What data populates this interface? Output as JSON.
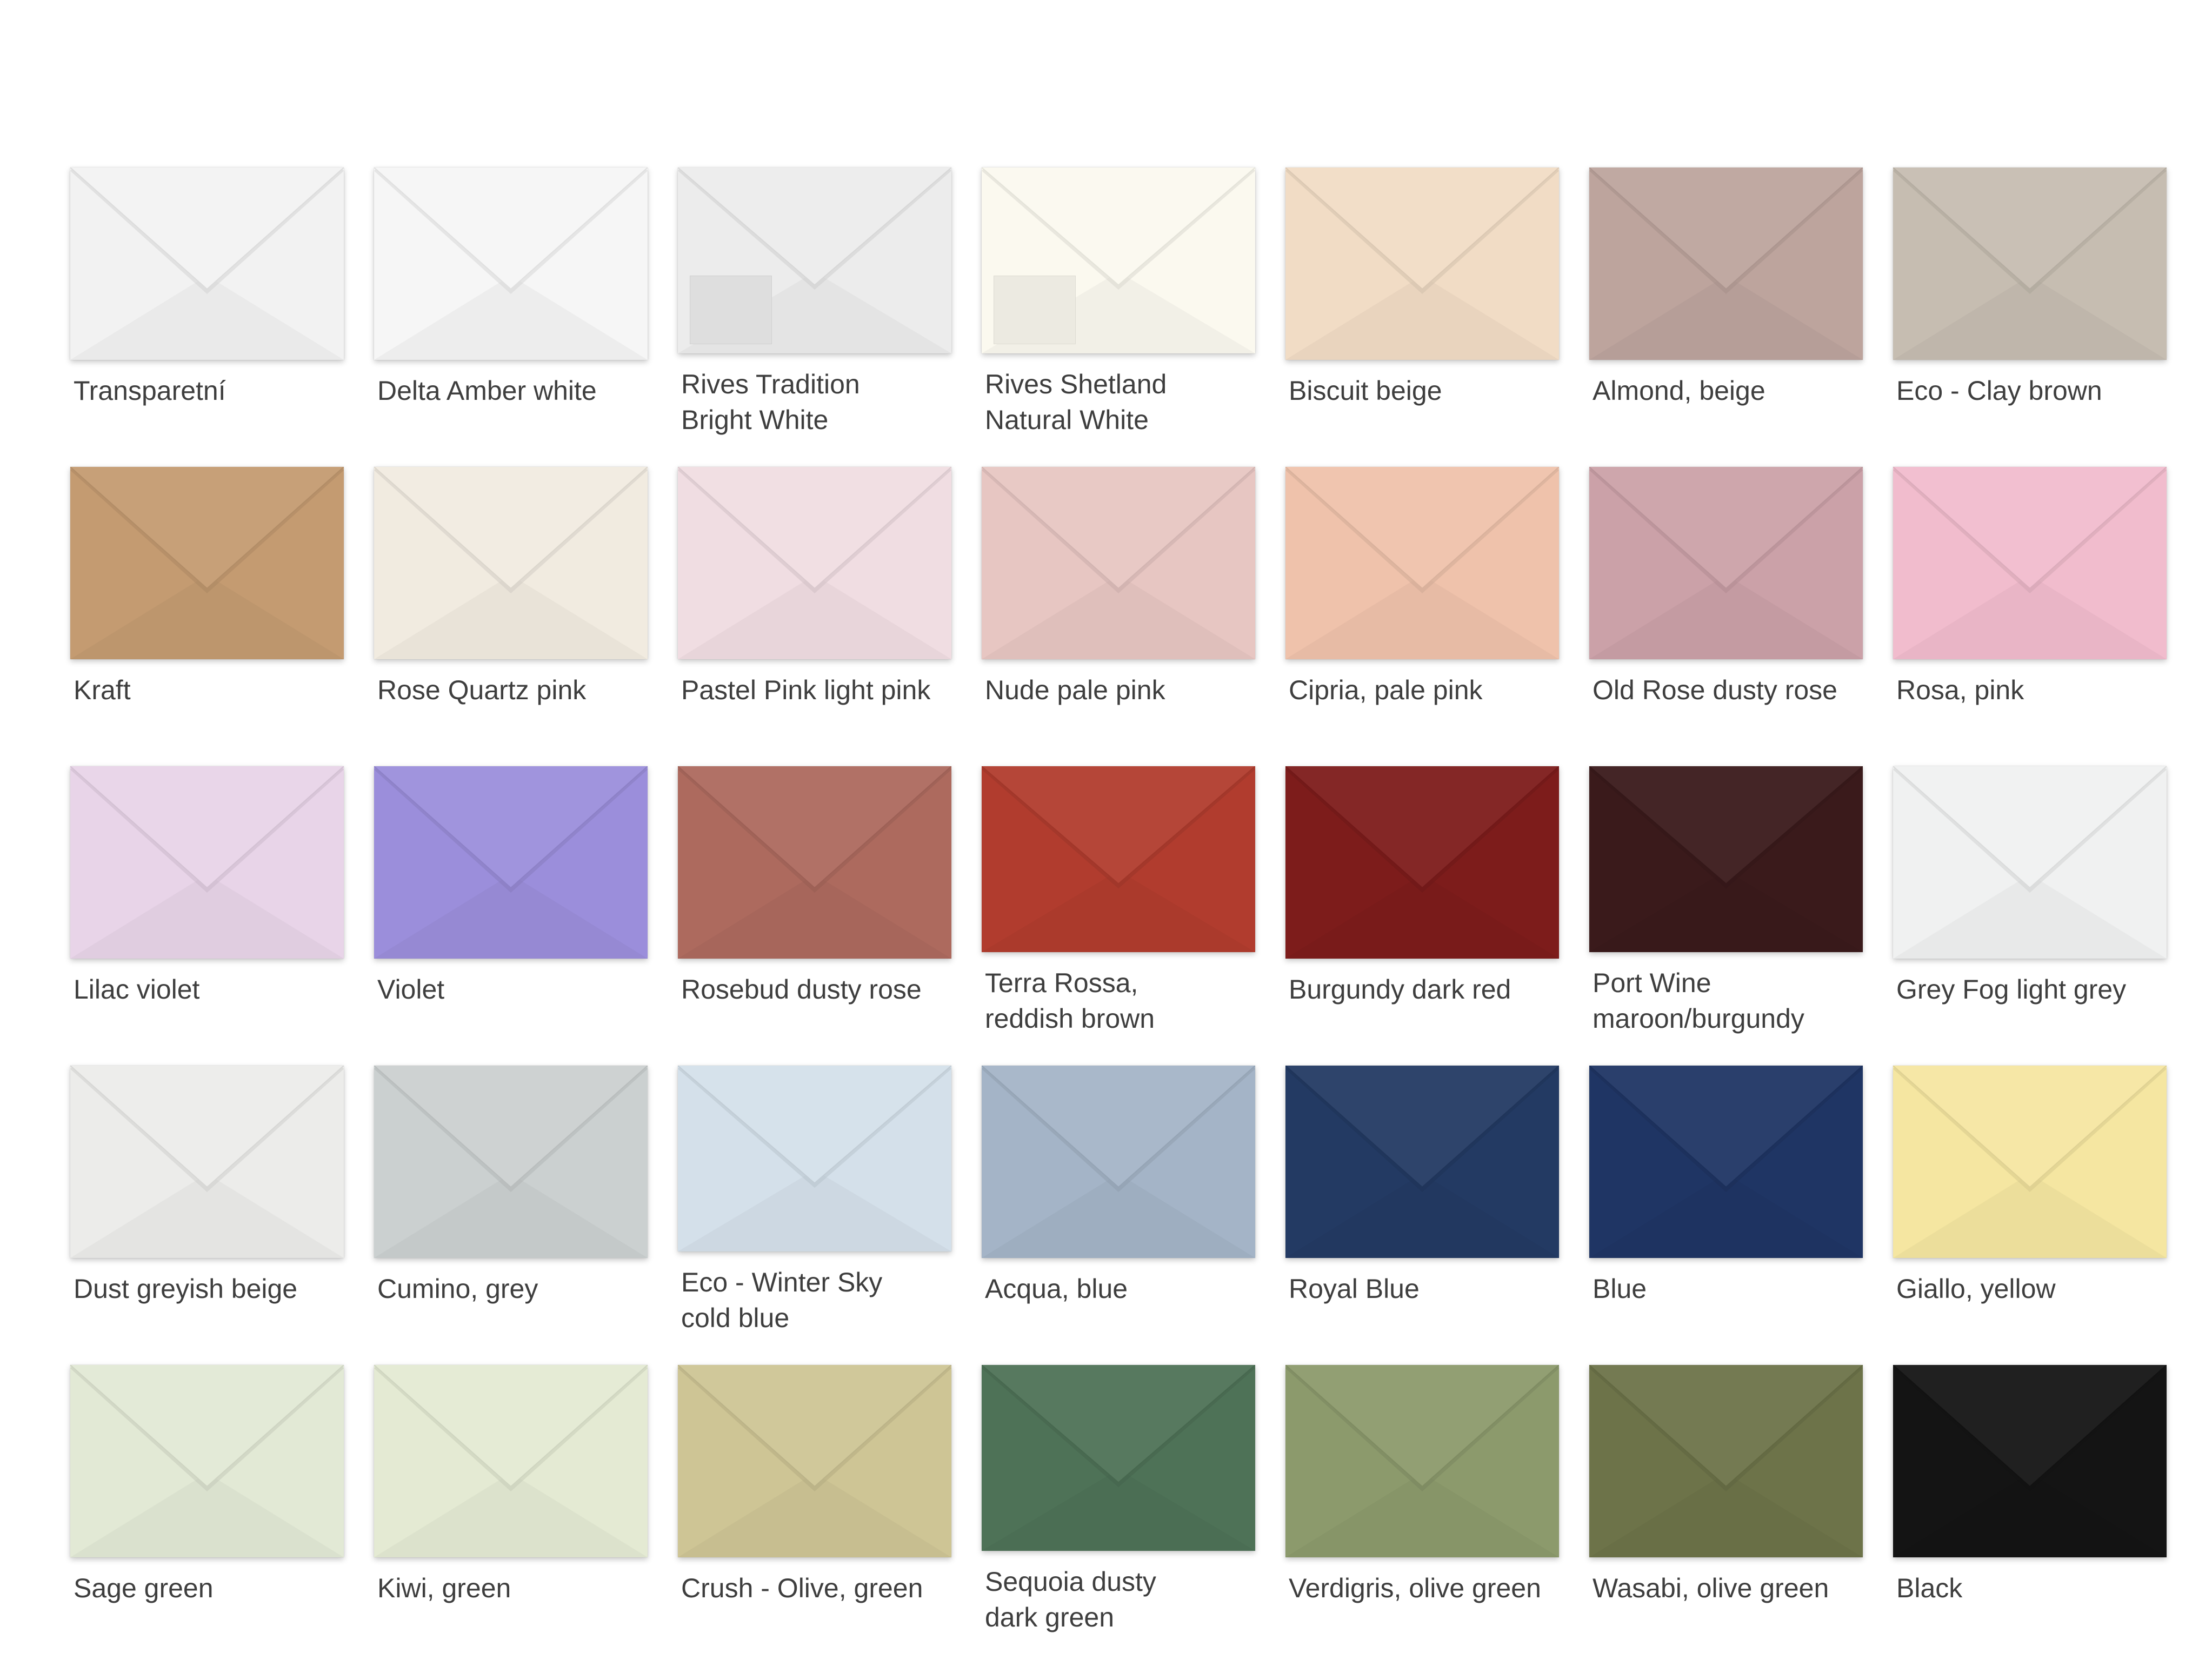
{
  "swatches": [
    {
      "name": "Transparetní",
      "color": "#f2f2f2"
    },
    {
      "name": "Delta Amber white",
      "color": "#f6f6f6"
    },
    {
      "name": "Rives Tradition\nBright White",
      "color": "#ececec",
      "texture": true
    },
    {
      "name": "Rives Shetland\nNatural White",
      "color": "#fbf9ef",
      "texture": true
    },
    {
      "name": "Biscuit beige",
      "color": "#f1dcc5"
    },
    {
      "name": "Almond, beige",
      "color": "#bda49d"
    },
    {
      "name": "Eco - Clay brown",
      "color": "#c6bdb1"
    },
    {
      "name": "Kraft",
      "color": "#c49b71"
    },
    {
      "name": "Rose Quartz pink",
      "color": "#f1ebe0"
    },
    {
      "name": "Pastel Pink light pink",
      "color": "#f0dde2"
    },
    {
      "name": "Nude pale pink",
      "color": "#e7c6c2"
    },
    {
      "name": "Cipria, pale pink",
      "color": "#efc2ab"
    },
    {
      "name": "Old Rose dusty rose",
      "color": "#cba1a8"
    },
    {
      "name": "Rosa, pink",
      "color": "#f1bccd"
    },
    {
      "name": "Lilac violet",
      "color": "#e8d4e8"
    },
    {
      "name": "Violet",
      "color": "#9b8edb"
    },
    {
      "name": "Rosebud dusty rose",
      "color": "#ad6a5e"
    },
    {
      "name": "Terra Rossa,\nreddish brown",
      "color": "#b13c2e"
    },
    {
      "name": "Burgundy dark red",
      "color": "#7d1c1b"
    },
    {
      "name": "Port Wine\nmaroon/burgundy",
      "color": "#3a1a1b"
    },
    {
      "name": "Grey Fog light grey",
      "color": "#f0f1f1"
    },
    {
      "name": "Dust greyish beige",
      "color": "#ececea"
    },
    {
      "name": "Cumino, grey",
      "color": "#cbd0d0"
    },
    {
      "name": "Eco - Winter Sky\ncold blue",
      "color": "#d4e0ea"
    },
    {
      "name": "Acqua, blue",
      "color": "#a4b4c7"
    },
    {
      "name": "Royal Blue",
      "color": "#233a63"
    },
    {
      "name": "Blue",
      "color": "#1f3564"
    },
    {
      "name": "Giallo, yellow",
      "color": "#f5e6a1"
    },
    {
      "name": "Sage green",
      "color": "#e2e9d5"
    },
    {
      "name": "Kiwi, green",
      "color": "#e4ead3"
    },
    {
      "name": "Crush - Olive, green",
      "color": "#cec595"
    },
    {
      "name": "Sequoia dusty\ndark green",
      "color": "#4e7257"
    },
    {
      "name": "Verdigris, olive green",
      "color": "#8c9a6c"
    },
    {
      "name": "Wasabi, olive green",
      "color": "#6d7349"
    },
    {
      "name": "Black",
      "color": "#141414"
    }
  ]
}
